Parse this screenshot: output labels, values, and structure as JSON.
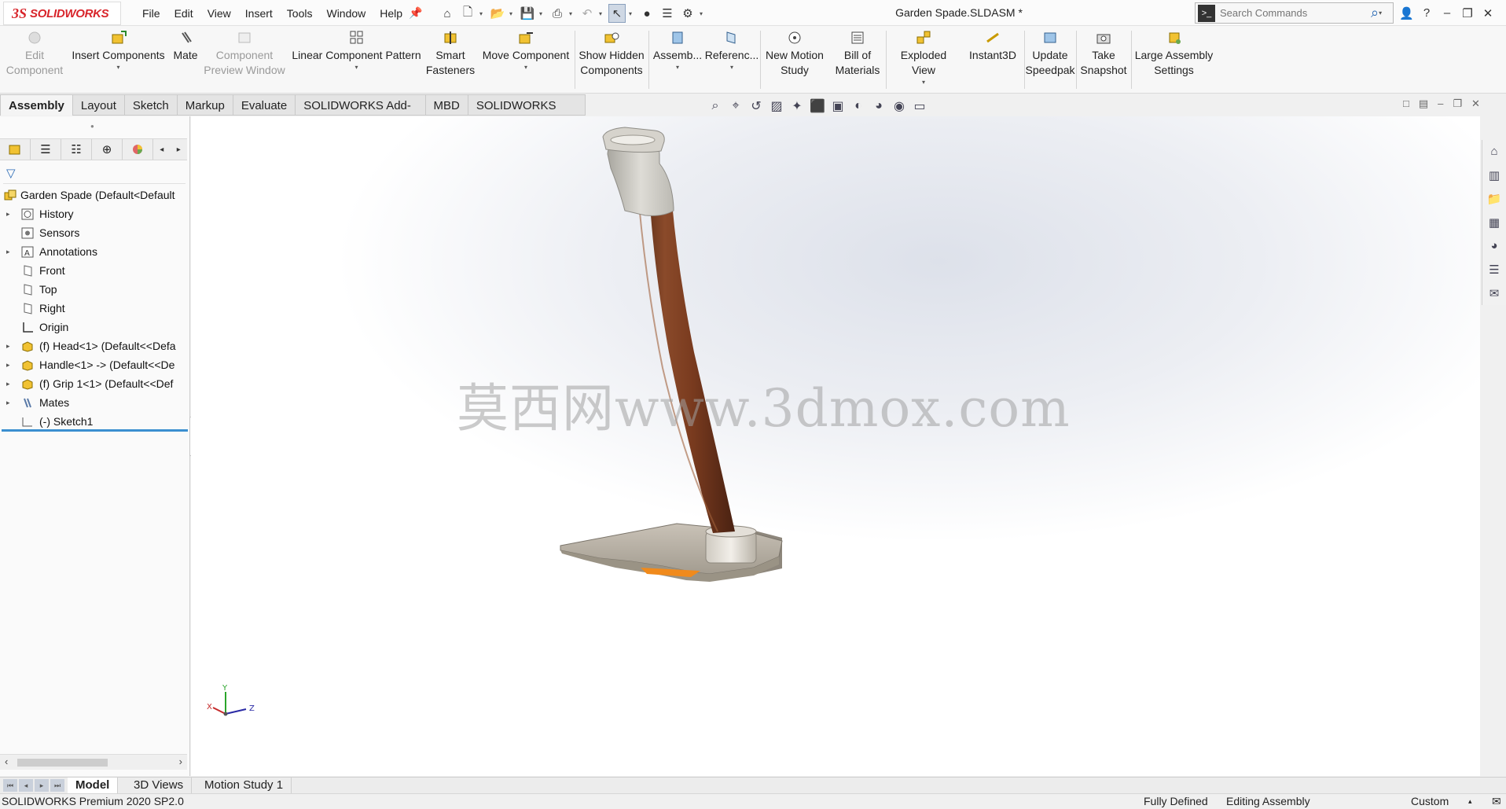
{
  "app": {
    "brand_ds": "3S",
    "brand_name": "SOLIDWORKS"
  },
  "menus": [
    "File",
    "Edit",
    "View",
    "Insert",
    "Tools",
    "Window",
    "Help"
  ],
  "document_title": "Garden Spade.SLDASM *",
  "search": {
    "placeholder": "Search Commands"
  },
  "ribbon": {
    "edit_component": "Edit Component",
    "insert_components": "Insert Components",
    "mate": "Mate",
    "component_preview_window": "Component Preview Window",
    "linear_component_pattern": "Linear Component Pattern",
    "smart_fasteners": "Smart Fasteners",
    "move_component": "Move Component",
    "show_hidden_components": "Show Hidden Components",
    "assembly_features": "Assemb...",
    "reference_geometry": "Referenc...",
    "new_motion_study": "New Motion Study",
    "bill_of_materials": "Bill of Materials",
    "exploded_view": "Exploded View",
    "instant3d": "Instant3D",
    "update_speedpak": "Update Speedpak",
    "take_snapshot": "Take Snapshot",
    "large_assembly_settings": "Large Assembly Settings"
  },
  "tabs": [
    "Assembly",
    "Layout",
    "Sketch",
    "Markup",
    "Evaluate",
    "SOLIDWORKS Add-Ins",
    "MBD",
    "SOLIDWORKS CAM"
  ],
  "tree": [
    {
      "label": "Garden Spade  (Default<Default",
      "icon": "assembly-icon"
    },
    {
      "label": "History",
      "icon": "history-icon"
    },
    {
      "label": "Sensors",
      "icon": "sensors-icon"
    },
    {
      "label": "Annotations",
      "icon": "annotations-icon"
    },
    {
      "label": "Front",
      "icon": "plane-icon"
    },
    {
      "label": "Top",
      "icon": "plane-icon"
    },
    {
      "label": "Right",
      "icon": "plane-icon"
    },
    {
      "label": "Origin",
      "icon": "origin-icon"
    },
    {
      "label": "(f) Head<1> (Default<<Defa",
      "icon": "part-icon"
    },
    {
      "label": "Handle<1> -> (Default<<De",
      "icon": "part-icon"
    },
    {
      "label": "(f) Grip 1<1> (Default<<Def",
      "icon": "part-icon"
    },
    {
      "label": "Mates",
      "icon": "mates-icon"
    },
    {
      "label": "(-) Sketch1",
      "icon": "sketch-icon"
    }
  ],
  "watermark": "莫西网www.3dmox.com",
  "triad": {
    "x": "X",
    "y": "Y",
    "z": "Z"
  },
  "bottom_tabs": [
    "Model",
    "3D Views",
    "Motion Study 1"
  ],
  "status": {
    "version": "SOLIDWORKS Premium 2020 SP2.0",
    "definition": "Fully Defined",
    "mode": "Editing Assembly",
    "units": "Custom"
  },
  "colors": {
    "brand_red": "#d8242a",
    "rollback_bar": "#3b8fd0",
    "handle_wood": "#7a3b1f",
    "grip": "#d4d2cb",
    "head_steel": "#b9b2a6",
    "highlight_orange": "#f08a1c"
  }
}
